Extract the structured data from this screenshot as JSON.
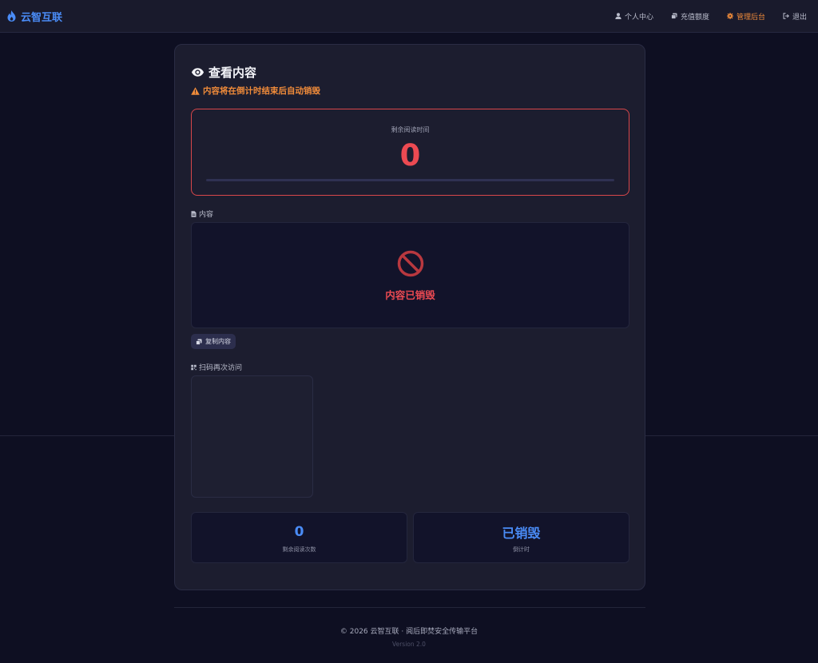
{
  "nav": {
    "brand": "云智互联",
    "links": [
      {
        "label": "个人中心",
        "icon": "user-icon"
      },
      {
        "label": "充值额度",
        "icon": "coins-icon"
      },
      {
        "label": "管理后台",
        "icon": "gear-icon",
        "active": true
      },
      {
        "label": "退出",
        "icon": "logout-icon"
      }
    ]
  },
  "page": {
    "title": "查看内容",
    "warning": "内容将在倒计时结束后自动销毁"
  },
  "timer": {
    "label": "剩余阅读时间",
    "value": "0",
    "progress": 0
  },
  "content": {
    "section_label": "内容",
    "destroyed_text": "内容已销毁"
  },
  "copy_button": {
    "label": "复制内容"
  },
  "qr": {
    "section_label": "扫码再次访问"
  },
  "stats": {
    "remaining_reads": {
      "value": "0",
      "label": "剩余阅读次数"
    },
    "countdown": {
      "value": "已销毁",
      "label": "倒计时"
    }
  },
  "footer": {
    "text": "© 2026 云智互联 · 阅后即焚安全传输平台",
    "version": "Version 2.0"
  },
  "colors": {
    "accent_blue": "#4a8cf7",
    "danger_red": "#ec4a52",
    "warning_orange": "#f08b3a",
    "background": "#0e0f22"
  }
}
